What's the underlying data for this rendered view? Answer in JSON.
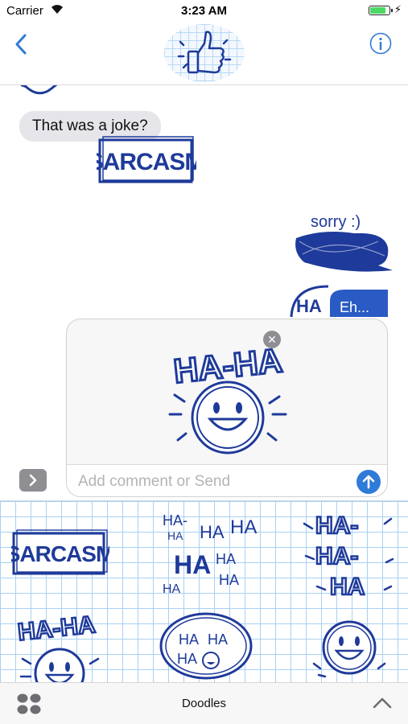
{
  "status_bar": {
    "carrier": "Carrier",
    "time": "3:23 AM"
  },
  "conversation": {
    "incoming_message": "That was a joke?",
    "stickers": {
      "sarcasm": "SARCASM",
      "sorry": "sorry :)",
      "ha_partial": "HA",
      "eh_partial": "Eh..."
    }
  },
  "compose": {
    "preview_sticker": "HA-HA",
    "placeholder": "Add comment or Send"
  },
  "drawer": {
    "stickers": [
      {
        "name": "SARCASM"
      },
      {
        "words": [
          "HA-",
          "HA",
          "HA",
          "HA",
          "HA",
          "HA",
          "HA",
          "HA"
        ]
      },
      {
        "words": [
          "HA-",
          "HA-",
          "HA"
        ]
      },
      {
        "words": [
          "HA-HA"
        ]
      },
      {
        "words": [
          "HA",
          "HA",
          "HA"
        ]
      },
      {
        "words": []
      }
    ]
  },
  "bottom_bar": {
    "title": "Doodles"
  },
  "colors": {
    "ink": "#1e3a9a",
    "accent": "#2f7bd8",
    "grid": "#a9d1f2"
  }
}
